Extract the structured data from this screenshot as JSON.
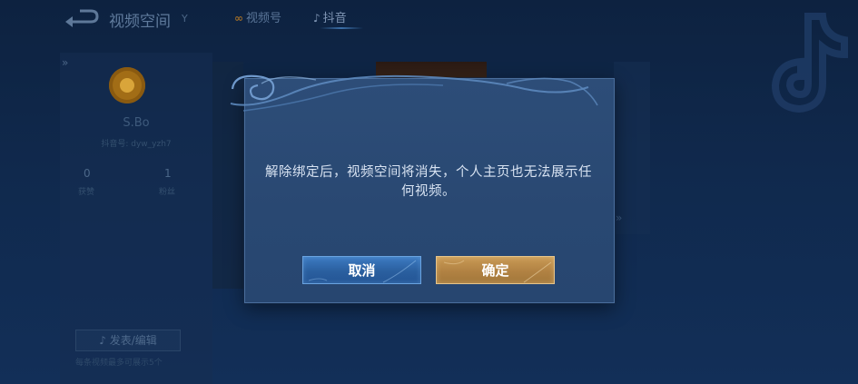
{
  "header": {
    "title": "视频空间",
    "title_mark": "Y",
    "tabs": [
      {
        "label": "视频号",
        "icon": "channels-icon",
        "active": false
      },
      {
        "label": "抖音",
        "icon": "douyin-icon",
        "active": true
      }
    ]
  },
  "profile": {
    "name": "S.Bo",
    "id_line": "抖音号: dyw_yzh7",
    "stats": [
      {
        "value": "0",
        "label": "获赞"
      },
      {
        "value": "1",
        "label": "粉丝"
      }
    ],
    "publish_label": "发表/编辑",
    "footnote": "每条视频最多可展示5个"
  },
  "dialog": {
    "message": "解除绑定后，视频空间将消失，个人主页也无法展示任何视频。",
    "cancel_label": "取消",
    "confirm_label": "确定"
  },
  "colors": {
    "cancel_button": "#2a5f9f",
    "confirm_button": "#b18243",
    "dialog_bg": "#2b4a75"
  }
}
